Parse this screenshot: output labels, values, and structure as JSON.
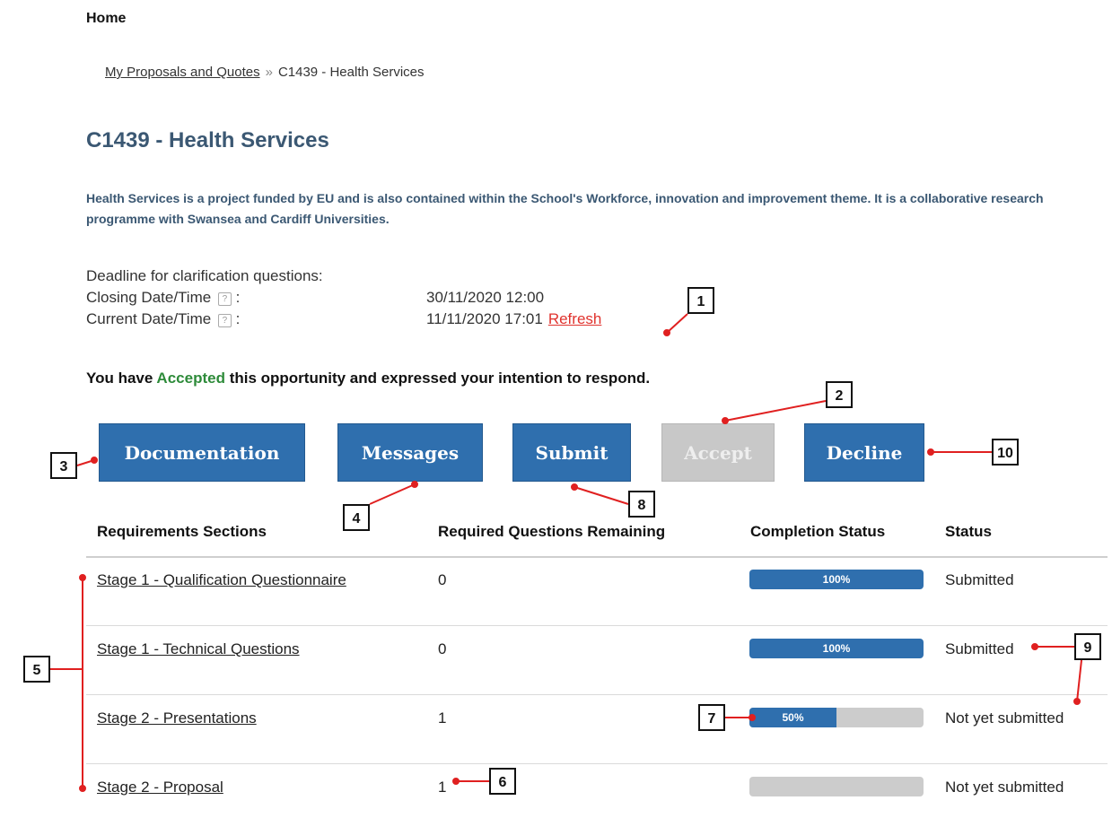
{
  "header": {
    "home": "Home"
  },
  "breadcrumb": {
    "link": "My Proposals and Quotes",
    "separator": "»",
    "current": "C1439 - Health Services"
  },
  "page": {
    "title": "C1439 - Health Services",
    "description": "Health Services is a project funded by EU and is also contained within the School's Workforce, innovation and improvement theme. It is a collaborative research programme with Swansea and Cardiff Universities."
  },
  "dates": {
    "deadline_label": "Deadline for clarification questions:",
    "closing_label": "Closing Date/Time",
    "closing_value": "30/11/2020 12:00",
    "current_label": "Current Date/Time",
    "current_value": "11/11/2020 17:01",
    "refresh": "Refresh",
    "help_glyph": "?",
    "colon": ":"
  },
  "status_message": {
    "prefix": "You have",
    "accepted": "Accepted",
    "suffix": "this opportunity and expressed your intention to respond."
  },
  "buttons": {
    "documentation": "Documentation",
    "messages": "Messages",
    "submit": "Submit",
    "accept": "Accept",
    "decline": "Decline"
  },
  "table": {
    "headers": [
      "Requirements Sections",
      "Required Questions Remaining",
      "Completion Status",
      "Status"
    ],
    "rows": [
      {
        "section": "Stage 1 - Qualification Questionnaire",
        "remaining": "0",
        "completion": 1.0,
        "completion_label": "100%",
        "status": "Submitted"
      },
      {
        "section": "Stage 1 - Technical Questions",
        "remaining": "0",
        "completion": 1.0,
        "completion_label": "100%",
        "status": "Submitted"
      },
      {
        "section": "Stage 2 - Presentations",
        "remaining": "1",
        "completion": 0.5,
        "completion_label": "50%",
        "status": "Not yet submitted"
      },
      {
        "section": "Stage 2 - Proposal",
        "remaining": "1",
        "completion": 0.0,
        "completion_label": "",
        "status": "Not yet submitted"
      }
    ]
  },
  "colors": {
    "primary": "#2f6fae",
    "title": "#3b5873",
    "accepted": "#2e8b3a",
    "refresh": "#e0332e",
    "annotation": "#e02020"
  },
  "callouts": [
    "1",
    "2",
    "3",
    "4",
    "5",
    "6",
    "7",
    "8",
    "9",
    "10"
  ]
}
